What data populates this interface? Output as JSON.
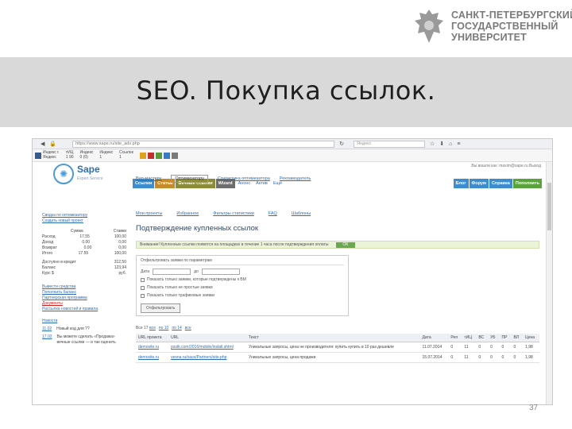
{
  "university": {
    "lines": [
      "САНКТ-ПЕТЕРБУРГСКИЙ",
      "ГОСУДАРСТВЕННЫЙ",
      "УНИВЕРСИТЕТ"
    ]
  },
  "slide": {
    "title": "SEO. Покупка ссылок.",
    "page_number": "37"
  },
  "browser": {
    "url": "https://www.sape.ru/site_ads.php",
    "search_placeholder": "Яндекс"
  },
  "sape": {
    "brand": "Sape",
    "brand_sub": "Expert Service",
    "account": "Вы вошли как: maxim@sape.ru  Выход",
    "tabs": [
      {
        "label": "Ссылки",
        "color": "#3d8ccf"
      },
      {
        "label": "Статьи",
        "color": "#c58b2c"
      },
      {
        "label": "Вечные ссылки",
        "color": "#8b8b3a"
      },
      {
        "label": "Wizard",
        "color": "#6d6d6d"
      }
    ],
    "plain_tabs": [
      "Анонс",
      "Актив",
      "Ещё"
    ],
    "right_tabs": [
      {
        "label": "Блог",
        "color": "#3d8ccf"
      },
      {
        "label": "Форум",
        "color": "#3d8ccf"
      },
      {
        "label": "Справка",
        "color": "#3d8ccf"
      },
      {
        "label": "Пополнить",
        "color": "#5aa23c"
      }
    ],
    "subnav": [
      "Вап-мастеру",
      "Оптимизатору",
      "Статистика оптимизатора",
      "Рекламодатель"
    ]
  },
  "sidebar": {
    "links_top": [
      "Сводка по оптимизатору",
      "Создать новый проект"
    ],
    "balance_header": [
      "Сумма",
      "Ставки"
    ],
    "rows": [
      {
        "label": "Расход",
        "a": "17.55",
        "b": "100,00"
      },
      {
        "label": "Доход",
        "a": "0.00",
        "b": "0,00"
      },
      {
        "label": "Возврат",
        "a": "0.00",
        "b": "0,00"
      },
      {
        "label": "Итого",
        "a": "17.55",
        "b": "100,00"
      }
    ],
    "credit": [
      {
        "label": "Доступно в кредит",
        "value": "312,50"
      },
      {
        "label": "Баланс",
        "value": "123,94"
      },
      {
        "label": "Курс $",
        "value": "руб."
      }
    ],
    "links_bottom": [
      "Вывести средства",
      "Пополнить баланс",
      "Партнерская программа",
      "Документы",
      "Рассылка новостей и правила"
    ],
    "news_label": "Новости",
    "news": [
      {
        "date": "11.02",
        "text": "Новый код для ??"
      },
      {
        "date": "17.02",
        "text": "Вы можете сделать «Продажа» вечные ссылки — и так оценить"
      }
    ]
  },
  "main": {
    "subtabs": [
      "Мои проекты",
      "Избранное",
      "Фильтры статистики",
      "FAQ",
      "Шаблоны"
    ],
    "heading": "Подтверждение купленных ссылок",
    "alert_text": "Внимание! Купленные ссылки появятся на площадках в течение 1 часа после подтверждения оплаты",
    "alert_button": "OK",
    "filter": {
      "title": "Отфильтровать заявки по параметрам",
      "date_label": "Дата",
      "date_to": "до",
      "options": [
        "Показать только заявки, которые подтверждены к ВМ",
        "Показать только не простые заявки",
        "Показать только трафиковые заявки"
      ],
      "button": "Отфильтровать"
    },
    "pager": {
      "prefix": "Все 17",
      "links": [
        "все",
        "по 10",
        "по 14",
        "все"
      ]
    },
    "table": {
      "headers": [
        "URL проекта",
        "URL",
        "Текст",
        "Дата",
        "Реп",
        "тИЦ",
        "ВС",
        "УБ",
        "ПР",
        "ВЛ",
        "Цена"
      ],
      "rows": [
        {
          "project": "demosite.ru",
          "url": "psstk.com/2016/mobile/install.shtml",
          "text": "Уникальные запросы, цена не производителя: купить купить в 10 раз дешевле",
          "date": "11.07.2014",
          "rep": "0",
          "tic": "11",
          "vs": "0",
          "ub": "0",
          "pr": "0",
          "vl": "0",
          "price": "1,98"
        },
        {
          "project": "demosite.ru",
          "url": "vesna.ru/vaux/Partners/site.php",
          "text": "Уникальные запросы, цена продажи",
          "date": "15.07.2014",
          "rep": "0",
          "tic": "11",
          "vs": "0",
          "ub": "0",
          "pr": "0",
          "vl": "0",
          "price": "1,98"
        }
      ]
    }
  }
}
